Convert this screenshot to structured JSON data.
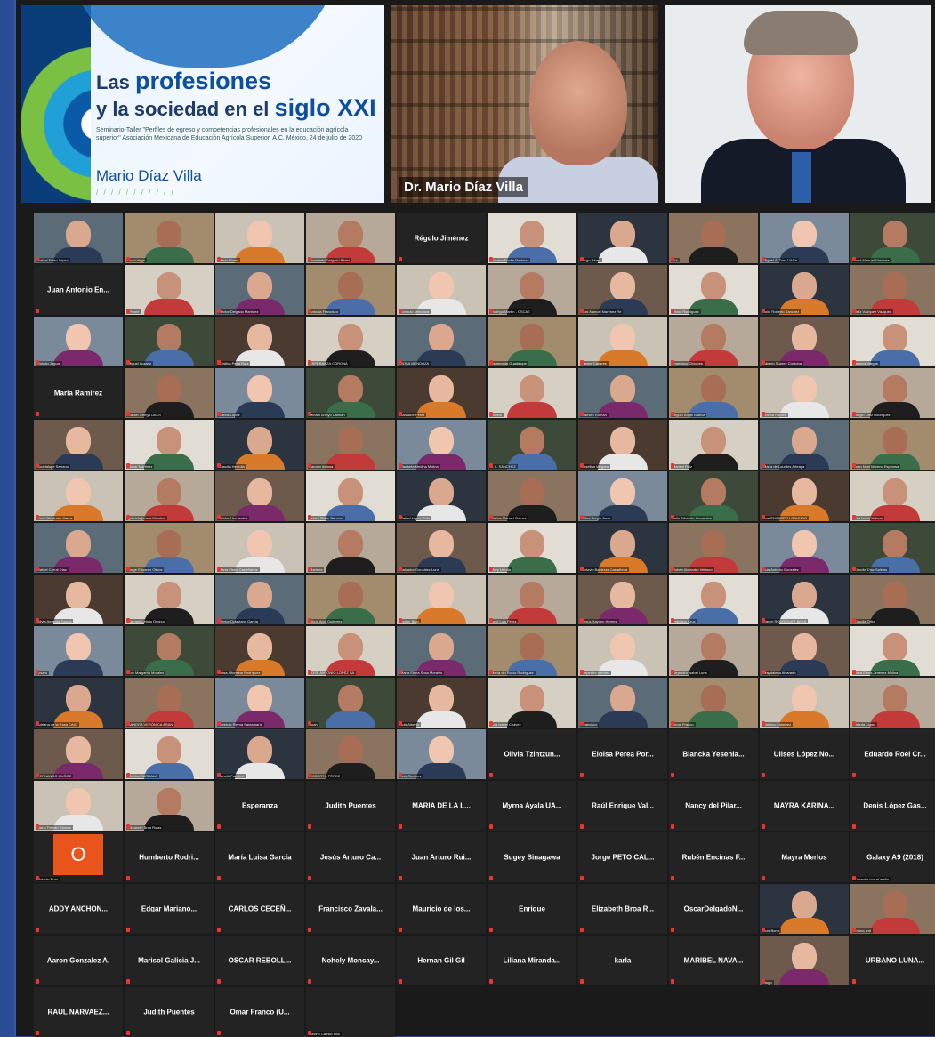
{
  "slide": {
    "line1_small": "Las",
    "line1_big": "profesiones",
    "line2_small": "y la sociedad en el",
    "line2_big": "siglo XXI",
    "subtitle": "Seminario-Taller \"Perfiles de egreso y competencias profesionales en la educación agrícola superior\" Asociación Mexicana de Educación Agrícola Superior, A.C. México, 24 de julio de 2020",
    "author": "Mario Díaz Villa",
    "dashes": "/ / / / / / / / / / /"
  },
  "speaker_name": "Dr. Mario Díaz Villa",
  "tiles": [
    {
      "t": "v",
      "cap": "Rafael Fiñeo López"
    },
    {
      "t": "v",
      "cap": "Juan Vega"
    },
    {
      "t": "v",
      "cap": "Mario Flores"
    },
    {
      "t": "v",
      "cap": "Humberto Delgado Pérez"
    },
    {
      "t": "n",
      "name": "Régulo Jiménez"
    },
    {
      "t": "v",
      "cap": "Susana Elodia Martínez"
    },
    {
      "t": "v",
      "cap": "Hugo Pérez"
    },
    {
      "t": "v",
      "cap": "Lía"
    },
    {
      "t": "v",
      "cap": "Miguel Á. Díaz UACh"
    },
    {
      "t": "v",
      "cap": "José Manuel Vázquez"
    },
    {
      "t": "n",
      "name": "Juan Antonio En..."
    },
    {
      "t": "v",
      "cap": "iPhone"
    },
    {
      "t": "v",
      "cap": "Héctor Delgado Martínez"
    },
    {
      "t": "v",
      "cap": "Antonia Francisco"
    },
    {
      "t": "v",
      "cap": "Lorenzo Mendoza"
    },
    {
      "t": "v",
      "cap": "Rodrigo Martín - CSCAE"
    },
    {
      "t": "v",
      "cap": "Luis Manuel Martínez Re"
    },
    {
      "t": "v",
      "cap": "Victor Rodríguez"
    },
    {
      "t": "v",
      "cap": "Julio Roberto Sánchez"
    },
    {
      "t": "v",
      "cap": "Ortiz Vázquez Vázquez"
    },
    {
      "t": "v",
      "cap": "Roldán Jaguar"
    },
    {
      "t": "v",
      "cap": "Miguel Lozano"
    },
    {
      "t": "v",
      "cap": "Cristina Peña Ruíz"
    },
    {
      "t": "v",
      "cap": "ESPERANZA CORONA"
    },
    {
      "t": "v",
      "cap": "ROSA MENDOZA"
    },
    {
      "t": "v",
      "cap": "Esmeralda Guadalupe"
    },
    {
      "t": "v",
      "cap": "Hector Cazares"
    },
    {
      "t": "v",
      "cap": "Francisco Ciclopes"
    },
    {
      "t": "v",
      "cap": "Alberto Suárez Córdoba"
    },
    {
      "t": "v",
      "cap": "Jessica Vargas"
    },
    {
      "t": "n",
      "name": "María Ramírez"
    },
    {
      "t": "v",
      "cap": "Rafael Ortega UACh"
    },
    {
      "t": "v",
      "cap": "Carlos López"
    },
    {
      "t": "v",
      "cap": "Miriam Arroyo Damián"
    },
    {
      "t": "v",
      "cap": "Salvador Pérez"
    },
    {
      "t": "v",
      "cap": "Varlein"
    },
    {
      "t": "v",
      "cap": "Damián Roman"
    },
    {
      "t": "v",
      "cap": "Miguel Ángel Blanca"
    },
    {
      "t": "v",
      "cap": "Marisa Robles"
    },
    {
      "t": "v",
      "cap": "Sergio Ortiz Rodríguez"
    },
    {
      "t": "v",
      "cap": "Guadalupe Serrano"
    },
    {
      "t": "v",
      "cap": "Oscar Martínez"
    },
    {
      "t": "v",
      "cap": "Claudia Heredia"
    },
    {
      "t": "v",
      "cap": "Jacobo Aldana"
    },
    {
      "t": "v",
      "cap": "Elsabeta Medina Molina"
    },
    {
      "t": "v",
      "cap": "J. L. SÁNCHEZ"
    },
    {
      "t": "v",
      "cap": "Josefina Vergara"
    },
    {
      "t": "v",
      "cap": "Marisol Ruiz"
    },
    {
      "t": "v",
      "cap": "María de Lourdes Arteaga"
    },
    {
      "t": "v",
      "cap": "Juan Noel Moreno Espinosa"
    },
    {
      "t": "v",
      "cap": "René Alejandro Ibarra"
    },
    {
      "t": "v",
      "cap": "gabriela jerusa Morales"
    },
    {
      "t": "v",
      "cap": "Héctor Hernández"
    },
    {
      "t": "v",
      "cap": "Arturo Marín Barrena"
    },
    {
      "t": "v",
      "cap": "Rafael López Ortiz"
    },
    {
      "t": "v",
      "cap": "Carlos Manuel Gómez"
    },
    {
      "t": "v",
      "cap": "Milos Sergio Juan"
    },
    {
      "t": "v",
      "cap": "Julio Eduardo Cervantes"
    },
    {
      "t": "v",
      "cap": "Ana ELIZABETH GALINDO"
    },
    {
      "t": "v",
      "cap": "Eva Lucía Vallano"
    },
    {
      "t": "v",
      "cap": "Rafael Corral Díaz"
    },
    {
      "t": "v",
      "cap": "Jorge Eduardo Olivos"
    },
    {
      "t": "v",
      "cap": "María Elena Castellanos"
    },
    {
      "t": "v",
      "cap": "Mariana"
    },
    {
      "t": "v",
      "cap": "Salvador González Luna"
    },
    {
      "t": "v",
      "cap": "Mary Urrutia"
    },
    {
      "t": "v",
      "cap": "Octavio Balderas Castañeda"
    },
    {
      "t": "v",
      "cap": "Rubén Alejandro Velasco"
    },
    {
      "t": "v",
      "cap": "Luis Antonio González"
    },
    {
      "t": "v",
      "cap": "Claudia Díaz Salinas"
    },
    {
      "t": "v",
      "cap": "Silvia Amanda García"
    },
    {
      "t": "v",
      "cap": "Carmen Leticia Orozco"
    },
    {
      "t": "v",
      "cap": "Héctor Octaviano García"
    },
    {
      "t": "v",
      "cap": "Olivia Abril Gutiérrez"
    },
    {
      "t": "v",
      "cap": "Esther Bigo"
    },
    {
      "t": "v",
      "cap": "José Luis Pérez"
    },
    {
      "t": "v",
      "cap": "Jesús Hayden Herrera"
    },
    {
      "t": "v",
      "cap": "Feliciano Cruz"
    },
    {
      "t": "v",
      "cap": "Daniel RODRÍGUEZ BEAR"
    },
    {
      "t": "v",
      "cap": "Claudia Ortiz"
    },
    {
      "t": "v",
      "cap": "Ipsam"
    },
    {
      "t": "v",
      "cap": "Zoe Margarita Morales"
    },
    {
      "t": "v",
      "cap": "Luisa Alfonsina Rodríguez"
    },
    {
      "t": "v",
      "cap": "JOSE ANTONIO LÓPEZ SA"
    },
    {
      "t": "v",
      "cap": "María Elena Sosa Morales"
    },
    {
      "t": "v",
      "cap": "María del Rocío Rodríguez"
    },
    {
      "t": "v",
      "cap": "alejandro ramírez"
    },
    {
      "t": "v",
      "cap": "Alejandro Isabel Luna"
    },
    {
      "t": "v",
      "cap": "Magdalena Alvarado"
    },
    {
      "t": "v",
      "cap": "Flora Elena Jiménez Molina"
    },
    {
      "t": "v",
      "cap": "Adriana de la Rosa CAIC"
    },
    {
      "t": "v",
      "cap": "SANDRA VERÓNICA ARAN"
    },
    {
      "t": "v",
      "cap": "Lorenzo Reyna Santamaría"
    },
    {
      "t": "v",
      "cap": "Juan"
    },
    {
      "t": "v",
      "cap": "Luis Alberto"
    },
    {
      "t": "v",
      "cap": "Ana Isabel Chávez"
    },
    {
      "t": "v",
      "cap": "Francisco"
    },
    {
      "t": "v",
      "cap": "Omar Franco"
    },
    {
      "t": "v",
      "cap": "Paloma Gutierrez"
    },
    {
      "t": "v",
      "cap": "Valeria López"
    },
    {
      "t": "v",
      "cap": "FERNANDO MUÑOZ"
    },
    {
      "t": "v",
      "cap": "Martha GARDALA"
    },
    {
      "t": "v",
      "cap": "Janeth Fuentes"
    },
    {
      "t": "v",
      "cap": "ROBERTO PÉREZ"
    },
    {
      "t": "v",
      "cap": "Luis Ramírez"
    },
    {
      "t": "n",
      "name": "Olivia Tzintzun..."
    },
    {
      "t": "n",
      "name": "Eloisa Perea Por..."
    },
    {
      "t": "n",
      "name": "Blancka Yesenia..."
    },
    {
      "t": "n",
      "name": "Ulises López No..."
    },
    {
      "t": "n",
      "name": "Eduardo Roel Cr..."
    },
    {
      "t": "v",
      "cap": "Darío Fernán Gómez"
    },
    {
      "t": "v",
      "cap": "Elizabeth Broa Rojas"
    },
    {
      "t": "n",
      "name": "Esperanza"
    },
    {
      "t": "n",
      "name": "Judith Puentes"
    },
    {
      "t": "n",
      "name": "MARIA DE LA L..."
    },
    {
      "t": "n",
      "name": "Myrna Ayala UA..."
    },
    {
      "t": "n",
      "name": "Raúl Enrique Val..."
    },
    {
      "t": "n",
      "name": "Nancy del Pilar..."
    },
    {
      "t": "n",
      "name": "MAYRA KARINA..."
    },
    {
      "t": "n",
      "name": "Denis López Gas..."
    },
    {
      "t": "o",
      "letter": "O",
      "cap": "Octavio Ruíz"
    },
    {
      "t": "n",
      "name": "Humberto Rodri..."
    },
    {
      "t": "n",
      "name": "María Luisa García"
    },
    {
      "t": "n",
      "name": "Jesús Arturo Ca..."
    },
    {
      "t": "n",
      "name": "Juan Arturo Rui..."
    },
    {
      "t": "n",
      "name": "Sugey Sinagawa"
    },
    {
      "t": "n",
      "name": "Jorge PETO CAL..."
    },
    {
      "t": "n",
      "name": "Rubén Encinas F..."
    },
    {
      "t": "n",
      "name": "Mayra Merlos"
    },
    {
      "t": "n",
      "name": "Galaxy A9 (2018)",
      "cap": "Conectar con el audio"
    },
    {
      "t": "n",
      "name": "ADDY ANCHON..."
    },
    {
      "t": "n",
      "name": "Edgar Mariano..."
    },
    {
      "t": "n",
      "name": "CARLOS CECEÑ..."
    },
    {
      "t": "n",
      "name": "Francisco Zavala..."
    },
    {
      "t": "n",
      "name": "Mauricio de los..."
    },
    {
      "t": "n",
      "name": "Enrique"
    },
    {
      "t": "n",
      "name": "Elizabeth Broa R..."
    },
    {
      "t": "n",
      "name": "OscarDelgadoN..."
    },
    {
      "t": "v",
      "cap": "Luis Borro"
    },
    {
      "t": "v",
      "cap": "Emma Iznt"
    },
    {
      "t": "n",
      "name": "Aaron Gonzalez A."
    },
    {
      "t": "n",
      "name": "Marisol Galicia J..."
    },
    {
      "t": "n",
      "name": "OSCAR REBOLL..."
    },
    {
      "t": "n",
      "name": "Nohely Moncay..."
    },
    {
      "t": "n",
      "name": "Hernan Gil Gil"
    },
    {
      "t": "n",
      "name": "Liliana Miranda..."
    },
    {
      "t": "n",
      "name": "karla"
    },
    {
      "t": "n",
      "name": "MARIBEL NAVA..."
    },
    {
      "t": "v",
      "cap": "Hugo"
    },
    {
      "t": "n",
      "name": "URBANO LUNA..."
    },
    {
      "t": "n",
      "name": "RAUL NARVAEZ..."
    },
    {
      "t": "n",
      "name": "Judith Puentes"
    },
    {
      "t": "n",
      "name": "Omar Franco (U..."
    },
    {
      "t": "n",
      "name": "",
      "cap": "Silvino Carrillo Pita"
    }
  ]
}
